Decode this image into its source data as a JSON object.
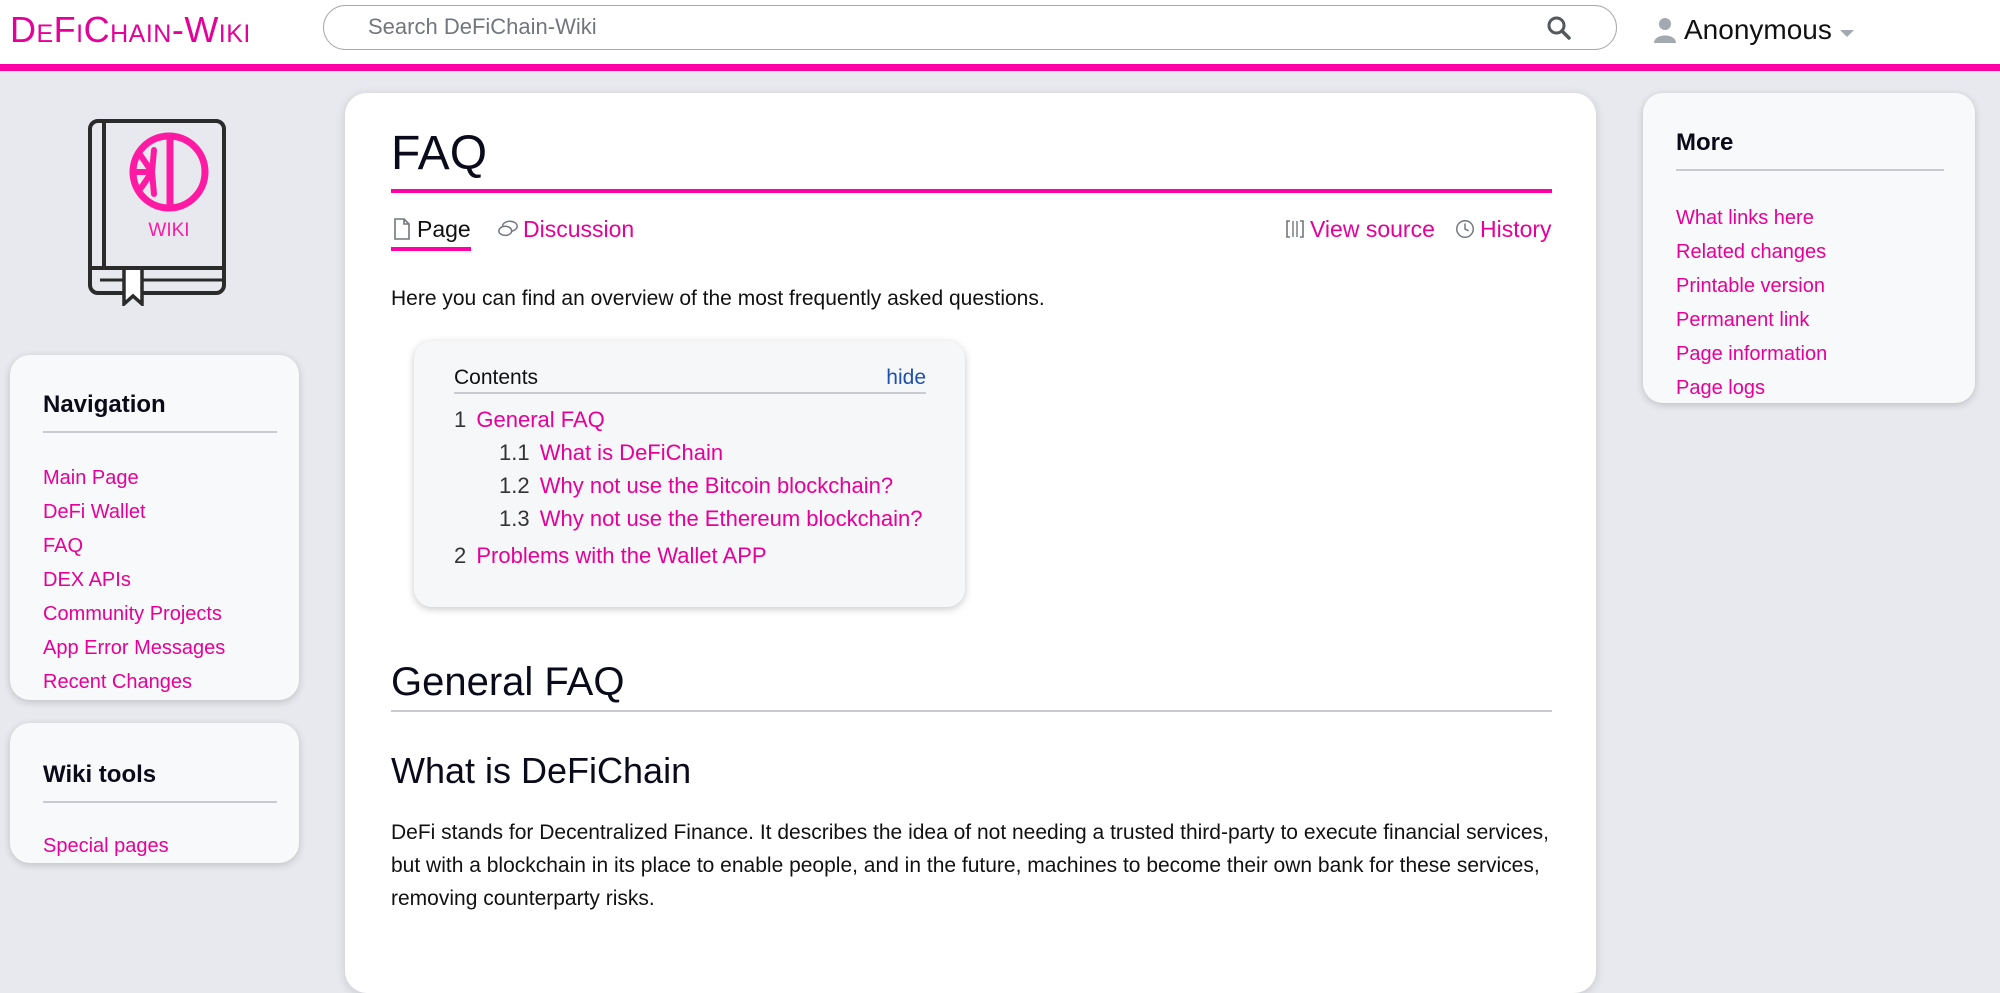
{
  "site": {
    "logo_text": "DeFiChain-Wiki",
    "logo_book_label": "WIKI"
  },
  "search": {
    "placeholder": "Search DeFiChain-Wiki"
  },
  "user": {
    "name": "Anonymous"
  },
  "navigation": {
    "title": "Navigation",
    "items": [
      {
        "label": "Main Page"
      },
      {
        "label": "DeFi Wallet"
      },
      {
        "label": "FAQ"
      },
      {
        "label": "DEX APIs"
      },
      {
        "label": "Community Projects"
      },
      {
        "label": "App Error Messages"
      },
      {
        "label": "Recent Changes"
      }
    ]
  },
  "wiki_tools": {
    "title": "Wiki tools",
    "items": [
      {
        "label": "Special pages"
      }
    ]
  },
  "more": {
    "title": "More",
    "items": [
      {
        "label": "What links here"
      },
      {
        "label": "Related changes"
      },
      {
        "label": "Printable version"
      },
      {
        "label": "Permanent link"
      },
      {
        "label": "Page information"
      },
      {
        "label": "Page logs"
      }
    ]
  },
  "page": {
    "title": "FAQ",
    "tabs": {
      "page": "Page",
      "discussion": "Discussion",
      "view_source": "View source",
      "history": "History"
    },
    "intro": "Here you can find an overview of the most frequently asked questions.",
    "toc": {
      "title": "Contents",
      "toggle": "hide",
      "entries": [
        {
          "num": "1",
          "label": "General FAQ"
        },
        {
          "num": "1.1",
          "label": "What is DeFiChain"
        },
        {
          "num": "1.2",
          "label": "Why not use the Bitcoin blockchain?"
        },
        {
          "num": "1.3",
          "label": "Why not use the Ethereum blockchain?"
        },
        {
          "num": "2",
          "label": "Problems with the Wallet APP"
        }
      ]
    },
    "section_heading": "General FAQ",
    "subsection_heading": "What is DeFiChain",
    "paragraph": "DeFi stands for Decentralized Finance. It describes the idea of not needing a trusted third-party to execute financial services, but with a blockchain in its place to enable people, and in the future, machines to become their own bank for these services, removing counterparty risks."
  },
  "colors": {
    "accent": "#ff00a8",
    "link": "#e6009a",
    "toc_toggle": "#1e50b4"
  }
}
